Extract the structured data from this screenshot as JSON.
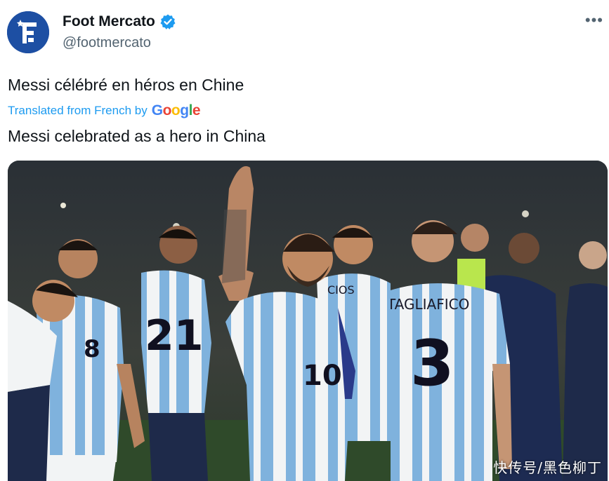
{
  "tweet": {
    "author": {
      "display_name": "Foot Mercato",
      "handle": "@footmercato",
      "verified": true,
      "avatar_icon": "foot-mercato-logo-icon",
      "avatar_color": "#1d4fa3"
    },
    "more_label": "•••",
    "original_text": "Messi célébré en héros en Chine",
    "translated_by_label": "Translated from French by",
    "translation_provider": "Google",
    "translated_text": "Messi celebrated as a hero in China",
    "media": {
      "alt_icon": "photo-argentina-players-celebrating",
      "jersey_numbers": [
        "8",
        "21",
        "10",
        "3"
      ],
      "jersey_name": "TAGLIAFICO",
      "jersey_name_partial": "CIOS"
    },
    "watermark": "快传号/黑色柳丁"
  },
  "colors": {
    "link_blue": "#1d9bf0",
    "verified_blue": "#1d9bf0",
    "text_primary": "#0f1419",
    "text_secondary": "#536471"
  }
}
